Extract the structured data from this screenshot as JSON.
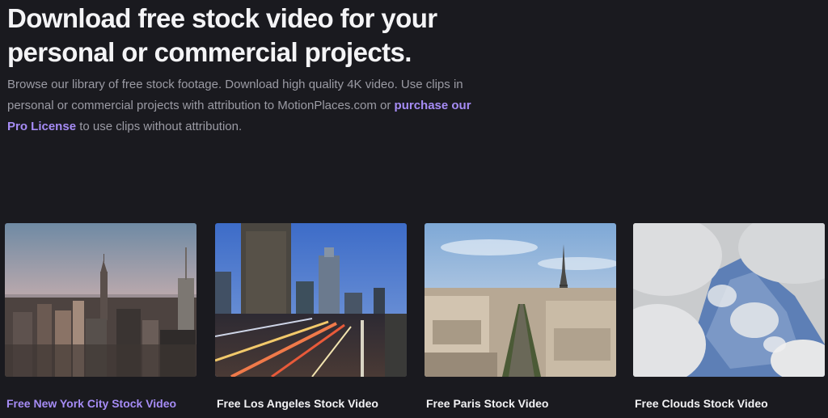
{
  "hero": {
    "heading_line1": "Download free stock video for your",
    "heading_line2": "personal or commercial projects.",
    "desc_part1": "Browse our library of free stock footage. Download high quality 4K video. Use clips in personal or commercial projects with attribution to MotionPlaces.com or ",
    "link_text": "purchase our Pro License",
    "desc_part2": " to use clips without attribution."
  },
  "cards": [
    {
      "title": "Free New York City Stock Video",
      "active": true
    },
    {
      "title": "Free Los Angeles Stock Video",
      "active": false
    },
    {
      "title": "Free Paris Stock Video",
      "active": false
    },
    {
      "title": "Free Clouds Stock Video",
      "active": false
    }
  ],
  "colors": {
    "background": "#1a1a1f",
    "accent": "#a68cf5",
    "text": "#f2f2f4",
    "muted": "#9b9ba4"
  }
}
